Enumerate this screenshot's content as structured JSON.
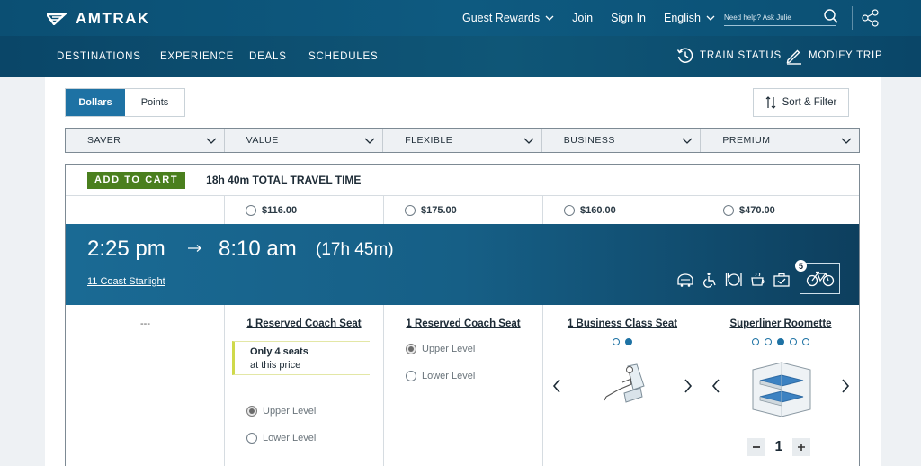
{
  "header": {
    "brand": "AMTRAK",
    "guest_rewards": "Guest Rewards",
    "join": "Join",
    "sign_in": "Sign In",
    "language": "English",
    "help_placeholder": "Need help? Ask Julie"
  },
  "nav": {
    "items": [
      "DESTINATIONS",
      "EXPERIENCE",
      "DEALS",
      "SCHEDULES"
    ],
    "train_status": "TRAIN STATUS",
    "modify_trip": "MODIFY TRIP"
  },
  "toggle": {
    "dollars": "Dollars",
    "points": "Points",
    "active": "Dollars"
  },
  "sort_filter": "Sort & Filter",
  "fare_classes": [
    "SAVER",
    "VALUE",
    "FLEXIBLE",
    "BUSINESS",
    "PREMIUM"
  ],
  "trip": {
    "add_to_cart": "ADD TO CART",
    "total_travel_time": "18h 40m TOTAL TRAVEL TIME",
    "prices": [
      "",
      "$116.00",
      "$175.00",
      "$160.00",
      "$470.00"
    ],
    "depart": "2:25 pm",
    "arrive": "8:10 am",
    "duration": "(17h 45m)",
    "train_name": "11 Coast Starlight",
    "bike_count": "5",
    "amenities": [
      "observation-car-icon",
      "accessible-icon",
      "dining-icon",
      "cafe-icon",
      "checked-baggage-icon",
      "bike-icon"
    ]
  },
  "options": {
    "saver_empty": "---",
    "value": {
      "title": "1 Reserved Coach Seat",
      "notice_line1": "Only 4 seats",
      "notice_line2": "at this price",
      "upper": "Upper Level",
      "lower": "Lower Level"
    },
    "flexible": {
      "title": "1 Reserved Coach Seat",
      "upper": "Upper Level",
      "lower": "Lower Level"
    },
    "business": {
      "title": "1 Business Class Seat",
      "dot_count": 2,
      "active_dot": 1
    },
    "premium": {
      "title": "Superliner Roomette",
      "dot_count": 5,
      "active_dot": 2,
      "quantity": "1"
    }
  },
  "colors": {
    "brand_blue": "#0b4f73",
    "accent": "#1e72a4",
    "cart_green": "#4a7f1e"
  }
}
